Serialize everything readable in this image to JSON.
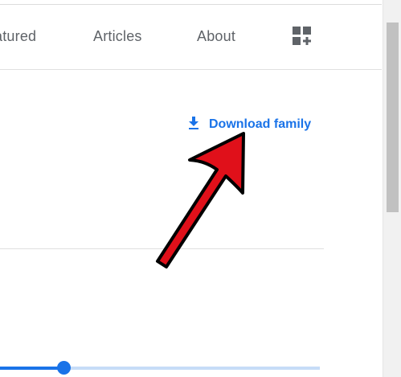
{
  "nav": {
    "featured_label": "atured",
    "articles_label": "Articles",
    "about_label": "About",
    "apps_icon": "grid-add-icon"
  },
  "download": {
    "label": "Download family",
    "icon": "download-icon"
  },
  "slider": {
    "value_fraction": 0.2
  },
  "annotation": {
    "arrow_color": "#e0101a",
    "arrow_icon": "red-arrow-icon"
  },
  "colors": {
    "accent": "#1a73e8",
    "nav_text": "#5f6368"
  }
}
